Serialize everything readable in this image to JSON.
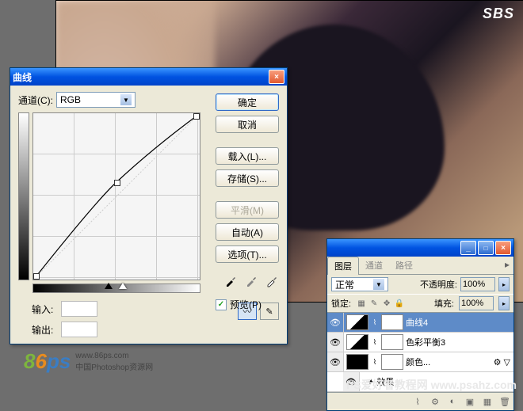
{
  "canvas": {
    "logo": "SBS"
  },
  "curves": {
    "title": "曲线",
    "channel_label": "通道(C):",
    "channel_value": "RGB",
    "buttons": {
      "ok": "确定",
      "cancel": "取消",
      "load": "载入(L)...",
      "save": "存储(S)...",
      "smooth": "平滑(M)",
      "auto": "自动(A)",
      "options": "选项(T)..."
    },
    "input_label": "输入:",
    "output_label": "输出:",
    "preview_label": "预览(P)"
  },
  "layers": {
    "tabs": {
      "layers": "图层",
      "channels": "通道",
      "paths": "路径"
    },
    "blend_mode": "正常",
    "opacity_label": "不透明度:",
    "opacity_value": "100%",
    "lock_label": "锁定:",
    "fill_label": "填充:",
    "fill_value": "100%",
    "items": [
      {
        "name": "曲线4",
        "selected": true,
        "type": "adj"
      },
      {
        "name": "色彩平衡3",
        "selected": false,
        "type": "adj"
      },
      {
        "name": "颜色...",
        "selected": false,
        "type": "fill",
        "hasEffects": true
      },
      {
        "name": "效果",
        "selected": false,
        "type": "fx"
      }
    ]
  },
  "watermark": {
    "site": "www.86ps.com",
    "desc": "中国Photoshop资源网",
    "right": "PS爱好者教程网 www.psahz.com"
  },
  "chart_data": {
    "type": "line",
    "title": "曲线",
    "xlabel": "输入",
    "ylabel": "输出",
    "xlim": [
      0,
      255
    ],
    "ylim": [
      0,
      255
    ],
    "series": [
      {
        "name": "RGB",
        "x": [
          0,
          128,
          255
        ],
        "y": [
          0,
          150,
          255
        ]
      }
    ]
  }
}
